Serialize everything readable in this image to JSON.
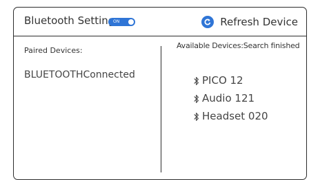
{
  "header": {
    "title": "Bluetooth Setting",
    "toggle": {
      "label": "ON",
      "state": "on",
      "color": "#2f75d6"
    },
    "refresh": {
      "label": "Refresh Device",
      "icon": "refresh-icon",
      "color": "#2f75d6"
    }
  },
  "paired": {
    "label": "Paired Devices:",
    "status": "BLUETOOTHConnected"
  },
  "available": {
    "label": "Available Devices:Search finished",
    "devices": [
      {
        "icon": "bluetooth-icon",
        "name": "PICO 12"
      },
      {
        "icon": "bluetooth-icon",
        "name": "Audio 121"
      },
      {
        "icon": "bluetooth-icon",
        "name": "Headset 020"
      }
    ]
  }
}
